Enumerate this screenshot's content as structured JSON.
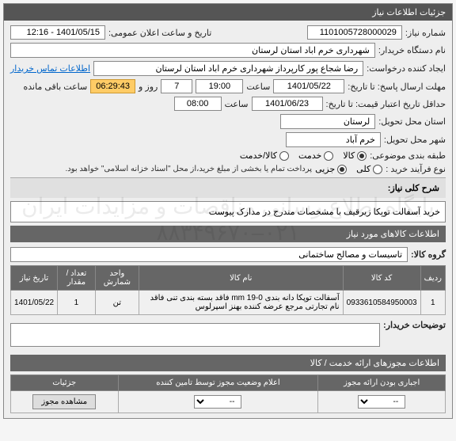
{
  "panel_title": "جزئیات اطلاعات نیاز",
  "fields": {
    "need_no_label": "شماره نیاز:",
    "need_no": "1101005728000029",
    "announce_label": "تاریخ و ساعت اعلان عمومی:",
    "announce_value": "1401/05/15 - 12:16",
    "buyer_label": "نام دستگاه خریدار:",
    "buyer_value": "شهرداری خرم اباد استان لرستان",
    "requester_label": "ایجاد کننده درخواست:",
    "requester_value": "رضا شجاع پور کارپرداز شهرداری خرم اباد استان لرستان",
    "contact_link": "اطلاعات تماس خریدار",
    "deadline_label": "مهلت ارسال پاسخ: تا تاریخ:",
    "deadline_date": "1401/05/22",
    "time_label": "ساعت",
    "deadline_time": "19:00",
    "days_left": "7",
    "days_word": "روز و",
    "countdown": "06:29:43",
    "countdown_suffix": "ساعت باقی مانده",
    "validity_label": "حداقل تاریخ اعتبار قیمت: تا تاریخ:",
    "validity_date": "1401/06/23",
    "validity_time": "08:00",
    "place_label": "استان محل تحویل:",
    "place_value": "لرستان",
    "city_label": "شهر محل تحویل:",
    "city_value": "خرم آباد",
    "class_label": "طبقه بندی موضوعی:",
    "class_goods": "کالا",
    "class_service": "خدمت",
    "class_both": "کالا/خدمت",
    "buy_type_label": "نوع فرآیند خرید :",
    "buy_type_total": "کلی",
    "buy_type_partial": "جزیی",
    "payment_note": "پرداخت تمام یا بخشی از مبلغ خرید،از محل \"اسناد خزانه اسلامی\" خواهد بود.",
    "desc_label": "شرح کلی نیاز:",
    "desc_value": "خرید آسفالت توپکا زیرقیف با مشخصات مندرج در مدارک پیوست",
    "goods_header": "اطلاعات کالاهای مورد نیاز",
    "group_label": "گروه کالا:",
    "group_value": "تاسیسات و مصالح ساختمانی",
    "remarks_label": "توضیحات خریدار:"
  },
  "table": {
    "headers": [
      "ردیف",
      "کد کالا",
      "نام کالا",
      "واحد شمارش",
      "تعداد / مقدار",
      "تاریخ نیاز"
    ],
    "row": {
      "idx": "1",
      "code": "0933610584950003",
      "name": "آسفالت توپکا دانه بندی 0-19 mm فاقد بسته بندی تنی فاقد نام تجارتی مرجع عرضه کننده بهنز اسپرلوس",
      "unit": "تن",
      "qty": "1",
      "date": "1401/05/22"
    }
  },
  "permits": {
    "header": "اطلاعات مجوزهای ارائه خدمت / کالا",
    "col_mandatory": "اجباری بودن ارائه مجوز",
    "col_status": "اعلام وضعیت مجوز توسط تامین کننده",
    "col_details": "جزئیات",
    "status_placeholder": "--",
    "btn_view": "مشاهده مجوز"
  },
  "watermark_line1": "پایگاه اطلاع رسانی مناقصات و مزایدات ایران",
  "watermark_line2": "۰۲۱–۸۸۳۴۹۶۷۰"
}
